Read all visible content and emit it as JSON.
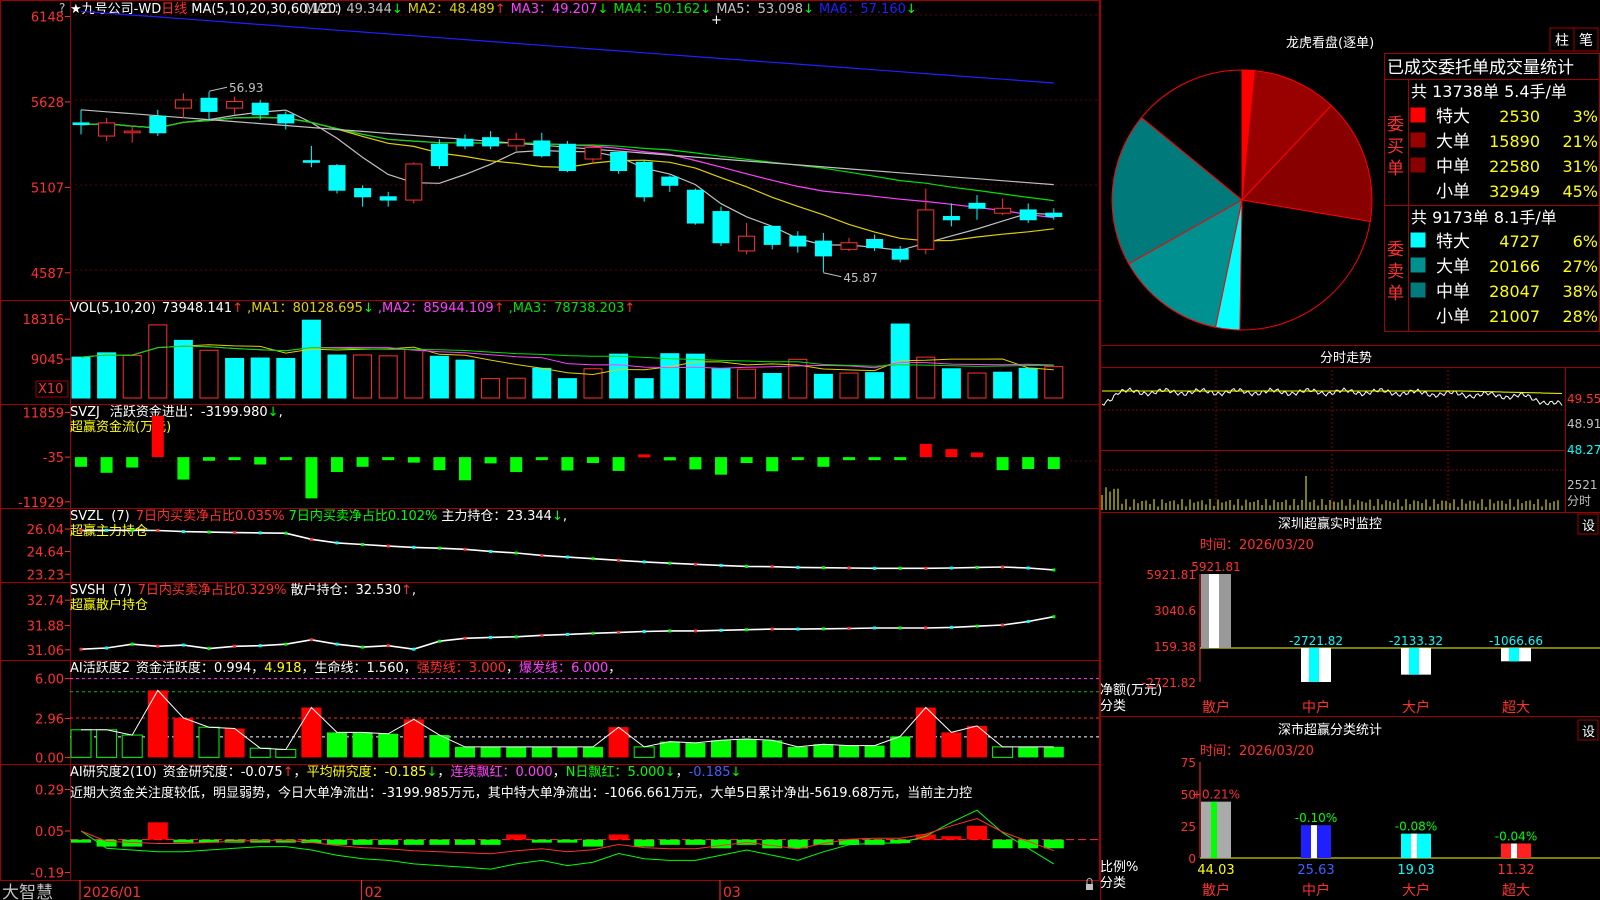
{
  "chart_data": [
    {
      "type": "candlestick",
      "title": "九号公司-WD",
      "period_label": "日线",
      "indicator_label": "MA(5,10,20,30,60,120)",
      "ma_values": [
        {
          "name": "MA1",
          "value": "49.344",
          "dir": "↓",
          "color": "#c0c0c0"
        },
        {
          "name": "MA2",
          "value": "48.489",
          "dir": "↑",
          "color": "#e0d000"
        },
        {
          "name": "MA3",
          "value": "49.207",
          "dir": "↓",
          "color": "#ff40ff"
        },
        {
          "name": "MA4",
          "value": "50.162",
          "dir": "↓",
          "color": "#00e000"
        },
        {
          "name": "MA5",
          "value": "53.098",
          "dir": "↓",
          "color": "#c0c0c0"
        },
        {
          "name": "MA6",
          "value": "57.160",
          "dir": "↓",
          "color": "#2020ff"
        }
      ],
      "y_ticks": [
        "6148",
        "5628",
        "5107",
        "4587"
      ],
      "y_tick_values": [
        61.48,
        56.28,
        51.07,
        45.87
      ],
      "ylim": [
        44.7,
        62.0
      ],
      "annotations": [
        {
          "text": "56.93",
          "x_index": 5,
          "y": 56.93
        },
        {
          "text": "45.87",
          "x_index": 29,
          "y": 45.87
        }
      ],
      "x_labels": [
        "2026/01",
        "02",
        "03"
      ],
      "x_label_index": [
        0,
        11,
        25
      ],
      "candles": [
        [
          0,
          55.0,
          54.9,
          55.8,
          54.3
        ],
        [
          1,
          54.2,
          55.0,
          55.3,
          53.9
        ],
        [
          2,
          54.4,
          54.5,
          54.8,
          53.8
        ],
        [
          3,
          55.4,
          54.4,
          55.8,
          54.2
        ],
        [
          4,
          55.9,
          56.4,
          56.8,
          55.3
        ],
        [
          5,
          56.5,
          55.7,
          56.9,
          55.2
        ],
        [
          6,
          55.9,
          56.3,
          56.6,
          55.5
        ],
        [
          7,
          56.2,
          55.5,
          56.4,
          55.2
        ],
        [
          8,
          55.5,
          55.0,
          55.7,
          54.6
        ],
        [
          9,
          52.7,
          52.6,
          53.6,
          52.3
        ],
        [
          10,
          52.4,
          50.9,
          52.5,
          50.7
        ],
        [
          11,
          51.0,
          50.5,
          51.2,
          49.9
        ],
        [
          12,
          50.5,
          50.3,
          50.8,
          49.9
        ],
        [
          13,
          50.3,
          52.5,
          52.6,
          50.1
        ],
        [
          14,
          53.7,
          52.4,
          54.0,
          52.2
        ],
        [
          15,
          54.0,
          53.6,
          54.3,
          53.4
        ],
        [
          16,
          54.1,
          53.6,
          54.5,
          53.4
        ],
        [
          17,
          53.6,
          54.0,
          54.4,
          53.3
        ],
        [
          18,
          53.9,
          53.0,
          54.4,
          52.9
        ],
        [
          19,
          53.7,
          52.1,
          53.9,
          52.0
        ],
        [
          20,
          52.8,
          53.5,
          53.7,
          52.5
        ],
        [
          21,
          53.2,
          52.1,
          53.2,
          51.9
        ],
        [
          22,
          52.6,
          50.5,
          52.7,
          50.2
        ],
        [
          23,
          51.7,
          51.2,
          51.8,
          50.8
        ],
        [
          24,
          50.9,
          48.9,
          51.0,
          48.8
        ],
        [
          25,
          49.6,
          47.7,
          49.9,
          47.5
        ],
        [
          26,
          47.2,
          48.1,
          48.9,
          47.0
        ],
        [
          27,
          48.7,
          47.6,
          48.7,
          47.3
        ],
        [
          28,
          48.1,
          47.5,
          48.4,
          47.1
        ],
        [
          29,
          47.8,
          46.9,
          48.3,
          45.9
        ],
        [
          30,
          47.3,
          47.7,
          48.0,
          47.2
        ],
        [
          31,
          47.9,
          47.4,
          48.2,
          47.2
        ],
        [
          32,
          47.3,
          46.7,
          47.5,
          46.5
        ],
        [
          33,
          47.3,
          49.7,
          51.0,
          47.0
        ],
        [
          34,
          49.3,
          49.1,
          50.1,
          48.7
        ],
        [
          35,
          50.1,
          49.8,
          50.6,
          49.1
        ],
        [
          36,
          49.5,
          49.8,
          50.4,
          49.4
        ],
        [
          37,
          49.7,
          49.1,
          50.1,
          48.9
        ],
        [
          38,
          49.5,
          49.3,
          49.8,
          49.1
        ]
      ]
    },
    {
      "type": "bar",
      "title": "VOL(5,10,20)",
      "value_text": "73948.141",
      "ma_values": [
        {
          "name": "MA1",
          "value": "80128.695",
          "dir": "↓",
          "color": "#e0d000"
        },
        {
          "name": "MA2",
          "value": "85944.109",
          "dir": "↑",
          "color": "#ff40ff"
        },
        {
          "name": "MA3",
          "value": "78738.203",
          "dir": "↑",
          "color": "#00e000"
        }
      ],
      "y_ticks": [
        "18316",
        "9045"
      ],
      "y_tick_values": [
        18316,
        9045
      ],
      "scale_label": "X10",
      "ylim": [
        0,
        20000
      ],
      "values": [
        9500,
        10500,
        9900,
        17000,
        13400,
        11100,
        9200,
        9300,
        9200,
        18100,
        10000,
        10000,
        9800,
        11300,
        9700,
        8800,
        4500,
        4600,
        6900,
        4500,
        6800,
        10200,
        4500,
        10300,
        10200,
        6800,
        6700,
        5700,
        9000,
        5500,
        5800,
        5900,
        17200,
        9500,
        6800,
        5800,
        6000,
        6900,
        7300
      ],
      "up": [
        false,
        false,
        true,
        true,
        false,
        true,
        false,
        false,
        false,
        false,
        false,
        true,
        true,
        true,
        false,
        false,
        true,
        true,
        false,
        false,
        true,
        false,
        false,
        false,
        false,
        false,
        true,
        false,
        true,
        false,
        true,
        false,
        false,
        true,
        false,
        true,
        false,
        false,
        true
      ]
    },
    {
      "type": "bar",
      "title": "SVZJ",
      "subtitle": "超赢资金流(万元)",
      "label": "活跃资金进出",
      "value_text": "-3199.980",
      "y_ticks": [
        "11859",
        "-35",
        "-11929"
      ],
      "y_tick_values": [
        11859,
        -35,
        -11929
      ],
      "ylim": [
        -12500,
        12500
      ],
      "values": [
        -2600,
        -4200,
        -2800,
        11000,
        -6000,
        -1000,
        -300,
        -2000,
        -600,
        -11000,
        -4000,
        -2600,
        -600,
        -1500,
        -3500,
        -6200,
        -1700,
        -4000,
        -500,
        -3600,
        -1600,
        -3700,
        700,
        -900,
        -3300,
        -4700,
        -1600,
        -3800,
        -400,
        -2600,
        -600,
        -300,
        -600,
        3500,
        2100,
        1200,
        -3500,
        -3200,
        -3200
      ]
    },
    {
      "type": "line",
      "title": "SVZL",
      "param": "(7)",
      "subtitle": "超赢主力持仓",
      "stat1": "7日内买卖净占比0.035%",
      "stat2": "7日内买卖净占比0.102%",
      "label": "主力持仓",
      "value_text": "23.344",
      "y_ticks": [
        "26.04",
        "24.64",
        "23.23"
      ],
      "y_tick_values": [
        26.04,
        24.64,
        23.23
      ],
      "ylim": [
        23.0,
        26.6
      ],
      "values": [
        25.95,
        25.96,
        25.96,
        25.95,
        25.88,
        25.85,
        25.82,
        25.8,
        25.78,
        25.4,
        25.18,
        25.08,
        24.98,
        24.9,
        24.85,
        24.78,
        24.65,
        24.55,
        24.4,
        24.3,
        24.2,
        24.1,
        24.0,
        23.92,
        23.85,
        23.78,
        23.72,
        23.7,
        23.66,
        23.64,
        23.62,
        23.6,
        23.6,
        23.6,
        23.62,
        23.66,
        23.68,
        23.62,
        23.5
      ]
    },
    {
      "type": "line",
      "title": "SVSH",
      "param": "(7)",
      "subtitle": "超赢散户持仓",
      "stat1": "7日内买卖净占比0.329%",
      "label": "散户持仓",
      "value_text": "32.530",
      "y_ticks": [
        "32.74",
        "31.88",
        "31.06"
      ],
      "y_tick_values": [
        32.74,
        31.88,
        31.06
      ],
      "ylim": [
        30.85,
        32.95
      ],
      "values": [
        31.08,
        31.12,
        31.25,
        31.18,
        31.22,
        31.1,
        31.18,
        31.2,
        31.25,
        31.4,
        31.25,
        31.15,
        31.2,
        31.08,
        31.35,
        31.45,
        31.48,
        31.5,
        31.55,
        31.58,
        31.62,
        31.65,
        31.68,
        31.7,
        31.7,
        31.72,
        31.74,
        31.76,
        31.76,
        31.77,
        31.78,
        31.8,
        31.8,
        31.8,
        31.82,
        31.86,
        31.9,
        32.02,
        32.18
      ]
    },
    {
      "type": "bar",
      "title": "AI活跃度2",
      "label": "资金活跃度",
      "value_text": "0.994",
      "value2_text": "4.918",
      "life_label": "生命线",
      "life_value": "1.560",
      "strong_label": "强势线",
      "strong_value": "3.000",
      "burst_label": "爆发线",
      "burst_value": "6.000",
      "y_ticks": [
        "6.00",
        "2.96",
        "0.00"
      ],
      "y_tick_values": [
        6.0,
        2.96,
        0.0
      ],
      "ylim": [
        -0.2,
        6.2
      ],
      "values": [
        2.1,
        2.1,
        1.7,
        5.1,
        3.0,
        2.3,
        2.2,
        0.7,
        0.6,
        3.8,
        1.9,
        1.9,
        1.8,
        2.9,
        1.7,
        0.8,
        0.8,
        0.8,
        0.8,
        0.8,
        0.8,
        2.3,
        0.8,
        1.2,
        1.1,
        1.3,
        1.4,
        1.3,
        0.8,
        1.0,
        0.9,
        0.9,
        1.6,
        3.8,
        1.9,
        2.4,
        0.8,
        0.8,
        0.8
      ],
      "styles": [
        "h",
        "h",
        "h",
        "r",
        "r",
        "h",
        "r",
        "h",
        "h",
        "r",
        "g",
        "g",
        "g",
        "r",
        "g",
        "g",
        "g",
        "g",
        "g",
        "g",
        "g",
        "r",
        "h",
        "g",
        "g",
        "g",
        "g",
        "g",
        "g",
        "g",
        "g",
        "g",
        "g",
        "r",
        "r",
        "r",
        "h",
        "g",
        "g"
      ]
    },
    {
      "type": "bar",
      "title": "AI研究度2(10)",
      "label": "资金研究度",
      "value_text": "-0.075",
      "avg_label": "平均研究度",
      "avg_value": "-0.185",
      "red_label": "连续飘红",
      "red_value": "0.000",
      "nred_label": "N日飘红",
      "nred_value": "5.000",
      "extra_value": "-0.185",
      "commentary": "近期大资金关注度较低，明显弱势，今日大单净流出：-3199.985万元，其中特大单净流出：-1066.661万元，大单5日累计净出-5619.68万元，当前主力控",
      "y_ticks": [
        "0.29",
        "0.05",
        "-0.19"
      ],
      "y_tick_values": [
        0.29,
        0.05,
        -0.19
      ],
      "ylim": [
        -0.21,
        0.31
      ],
      "values": [
        0.0,
        -0.04,
        -0.04,
        0.1,
        0.0,
        0.0,
        0.0,
        0.0,
        0.0,
        -0.02,
        -0.03,
        -0.03,
        -0.03,
        -0.03,
        -0.03,
        -0.03,
        -0.03,
        0.03,
        -0.01,
        -0.01,
        -0.04,
        0.03,
        -0.04,
        -0.03,
        -0.03,
        -0.05,
        -0.03,
        -0.05,
        -0.05,
        -0.03,
        -0.03,
        -0.03,
        -0.02,
        0.03,
        0.02,
        0.08,
        -0.05,
        -0.05,
        -0.05
      ],
      "line": [
        0.05,
        -0.05,
        -0.06,
        -0.07,
        -0.07,
        -0.06,
        -0.05,
        -0.04,
        -0.04,
        -0.06,
        -0.09,
        -0.11,
        -0.12,
        -0.14,
        -0.15,
        -0.16,
        -0.17,
        -0.14,
        -0.12,
        -0.15,
        -0.13,
        -0.08,
        -0.11,
        -0.12,
        -0.12,
        -0.09,
        -0.06,
        -0.09,
        -0.12,
        -0.07,
        -0.03,
        -0.02,
        -0.02,
        0.02,
        0.1,
        0.17,
        0.04,
        -0.05,
        -0.14
      ]
    },
    {
      "type": "pie",
      "title": "龙虎看盘(逐单)",
      "values": [
        3,
        21,
        31,
        45,
        6,
        27,
        38,
        28
      ],
      "colors": [
        "#ff0000",
        "#990000",
        "#880000",
        "#000000",
        "#00ffff",
        "#009090",
        "#007a7a",
        "#000000"
      ]
    },
    {
      "type": "line",
      "title": "分时走势",
      "y_ticks": [
        "49.55",
        "48.91",
        "48.27",
        "2521",
        "分时"
      ]
    },
    {
      "type": "bar",
      "title": "深圳超赢实时监控",
      "date": "时间：2026/03/20",
      "y_ticks": [
        "5921.81",
        "3040.6",
        "159.38",
        "-2721.82"
      ],
      "ylabel": "净额(万元)",
      "xlabel": "分类",
      "categories": [
        "散户",
        "中户",
        "大户",
        "超大"
      ],
      "values": [
        5921.81,
        -2721.82,
        -2133.32,
        -1066.66
      ],
      "value_labels": [
        "5921.81",
        "-2721.82",
        "-2133.32",
        "-1066.66"
      ],
      "ylim": [
        -2721.82,
        5921.81
      ]
    },
    {
      "type": "bar",
      "title": "深市超赢分类统计",
      "date": "时间：2026/03/20",
      "y_ticks": [
        "75",
        "50",
        "25",
        "0"
      ],
      "ylabel": "比例%",
      "xlabel": "分类",
      "categories": [
        "散户",
        "中户",
        "大户",
        "超大"
      ],
      "values": [
        44.03,
        25.63,
        19.03,
        11.32
      ],
      "change_labels": [
        "+0.21%",
        "-0.10%",
        "-0.08%",
        "-0.04%"
      ],
      "ylim": [
        0,
        75
      ]
    }
  ],
  "panel": {
    "buttons": [
      "柱",
      "笔"
    ],
    "stat_title": "已成交委托单成交量统计",
    "buy": {
      "label": "委买单",
      "summary": "共 13738单 5.4手/单",
      "rows": [
        {
          "name": "特大",
          "value": "2530",
          "pct": "3%",
          "color": "#ff0000"
        },
        {
          "name": "大单",
          "value": "15890",
          "pct": "21%",
          "color": "#990000"
        },
        {
          "name": "中单",
          "value": "22580",
          "pct": "31%",
          "color": "#880000"
        },
        {
          "name": "小单",
          "value": "32949",
          "pct": "45%",
          "color": "#000000"
        }
      ]
    },
    "sell": {
      "label": "委卖单",
      "summary": "共 9173单 8.1手/单",
      "rows": [
        {
          "name": "特大",
          "value": "4727",
          "pct": "6%",
          "color": "#00ffff"
        },
        {
          "name": "大单",
          "value": "20166",
          "pct": "27%",
          "color": "#009090"
        },
        {
          "name": "中单",
          "value": "28047",
          "pct": "38%",
          "color": "#007a7a"
        },
        {
          "name": "小单",
          "value": "21007",
          "pct": "28%",
          "color": "#000000"
        }
      ]
    },
    "settings_label": "设"
  },
  "footer": {
    "app": "大智慧"
  }
}
